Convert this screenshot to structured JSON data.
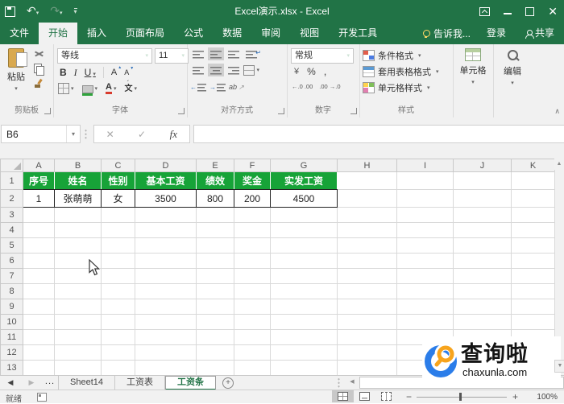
{
  "window": {
    "title": "Excel演示.xlsx - Excel"
  },
  "tabs": [
    {
      "label": "文件"
    },
    {
      "label": "开始",
      "active": true
    },
    {
      "label": "插入"
    },
    {
      "label": "页面布局"
    },
    {
      "label": "公式"
    },
    {
      "label": "数据"
    },
    {
      "label": "审阅"
    },
    {
      "label": "视图"
    },
    {
      "label": "开发工具"
    },
    {
      "label": "告诉我..."
    },
    {
      "label": "登录"
    },
    {
      "label": "共享"
    }
  ],
  "ribbon": {
    "paste_label": "粘贴",
    "group_labels": {
      "clipboard": "剪贴板",
      "font": "字体",
      "alignment": "对齐方式",
      "number": "数字",
      "style": "样式"
    },
    "font_name": "等线",
    "font_size": "11",
    "bold": "B",
    "italic": "I",
    "underline": "U",
    "grow_font": "A",
    "shrink_font": "A",
    "font_color_letter": "A",
    "phonetic": "文",
    "number_format": "常规",
    "percent": "%",
    "comma": ",",
    "style_buttons": [
      "条件格式",
      "套用表格格式",
      "单元格样式"
    ],
    "cells_label": "单元格",
    "editing_label": "编辑"
  },
  "formula_bar": {
    "name_box": "B6",
    "fx_label": "fx",
    "formula_value": ""
  },
  "grid": {
    "col_headers": [
      "A",
      "B",
      "C",
      "D",
      "E",
      "F",
      "G",
      "H",
      "I",
      "J",
      "K"
    ],
    "row_headers": [
      "1",
      "2",
      "3",
      "4",
      "5",
      "6",
      "7",
      "8",
      "9",
      "10",
      "11",
      "12",
      "13"
    ],
    "table_headers": [
      "序号",
      "姓名",
      "性别",
      "基本工资",
      "绩效",
      "奖金",
      "实发工资"
    ],
    "table_row": [
      "1",
      "张萌萌",
      "女",
      "3500",
      "800",
      "200",
      "4500"
    ]
  },
  "sheet_bar": {
    "ellipsis": "...",
    "tabs": [
      {
        "label": "Sheet14"
      },
      {
        "label": "工资表"
      },
      {
        "label": "工资条",
        "active": true
      }
    ]
  },
  "status_bar": {
    "ready_label": "就绪",
    "zoom_level": "100%"
  },
  "watermark": {
    "brand": "查询啦",
    "domain": "chaxunla.com"
  },
  "colors": {
    "excel_green": "#217346",
    "table_header_green": "#17a338",
    "watermark_blue": "#2b7de9",
    "watermark_orange": "#f7a41d"
  }
}
